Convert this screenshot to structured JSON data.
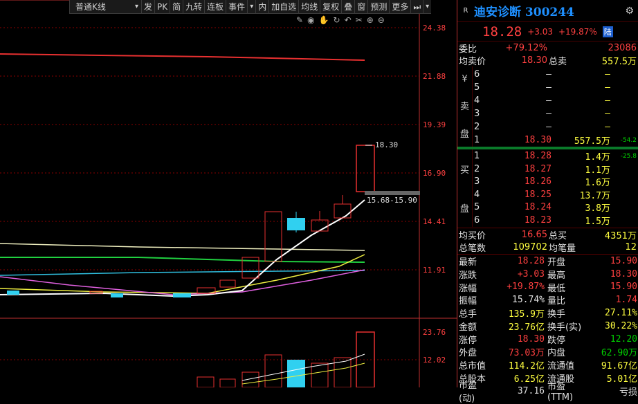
{
  "toolbar": {
    "items": [
      "普通K线",
      "发",
      "PK",
      "简",
      "九转",
      "连板",
      "事件",
      "内",
      "加自选",
      "均线",
      "复权",
      "叠",
      "窗",
      "预测",
      "更多"
    ],
    "arrow": "▾"
  },
  "chart": {
    "price_labels": [
      "24.38",
      "21.88",
      "19.39",
      "16.90",
      "14.41",
      "11.91"
    ],
    "volume_labels": [
      "23.76",
      "12.02"
    ],
    "high_annotation": "18.30",
    "range_annotation": "15.68-15.90",
    "tool_icons": [
      "pen-icon",
      "eye-icon",
      "hand-icon",
      "refresh-icon",
      "undo-icon",
      "scissors-icon",
      "zoom-in-icon",
      "zoom-out-icon"
    ]
  },
  "chart_data": {
    "type": "candlestick",
    "price_axis": [
      11.91,
      14.41,
      16.9,
      19.39,
      21.88,
      24.38
    ],
    "volume_axis": [
      12.02,
      23.76
    ],
    "annotations": [
      "18.30",
      "15.68-15.90"
    ]
  },
  "stock": {
    "r_mark": "R",
    "title": "迪安诊断 300244",
    "price": "18.28",
    "change": "+3.03",
    "pct": "+19.87%",
    "tag": "陆"
  },
  "summary": [
    {
      "label": "委比",
      "v1": "+79.12%",
      "label2": "",
      "v2": "23086"
    },
    {
      "label": "均卖价",
      "v1": "18.30",
      "label2": "总卖",
      "v2": "557.5万"
    }
  ],
  "sell_side": [
    "¥",
    "卖",
    "盘"
  ],
  "buy_side": [
    "买",
    "盘"
  ],
  "sell": [
    {
      "lvl": "6",
      "price": "–",
      "vol": "–",
      "chg": ""
    },
    {
      "lvl": "5",
      "price": "–",
      "vol": "–",
      "chg": ""
    },
    {
      "lvl": "4",
      "price": "–",
      "vol": "–",
      "chg": ""
    },
    {
      "lvl": "3",
      "price": "–",
      "vol": "–",
      "chg": ""
    },
    {
      "lvl": "2",
      "price": "–",
      "vol": "–",
      "chg": ""
    },
    {
      "lvl": "1",
      "price": "18.30",
      "vol": "557.5万",
      "chg": "-54.2"
    }
  ],
  "buy": [
    {
      "lvl": "1",
      "price": "18.28",
      "vol": "1.4万",
      "chg": "-25.8"
    },
    {
      "lvl": "2",
      "price": "18.27",
      "vol": "1.1万",
      "chg": ""
    },
    {
      "lvl": "3",
      "price": "18.26",
      "vol": "1.6万",
      "chg": ""
    },
    {
      "lvl": "4",
      "price": "18.25",
      "vol": "13.7万",
      "chg": ""
    },
    {
      "lvl": "5",
      "price": "18.24",
      "vol": "3.8万",
      "chg": ""
    },
    {
      "lvl": "6",
      "price": "18.23",
      "vol": "1.5万",
      "chg": ""
    }
  ],
  "buy_summary": [
    {
      "label": "均买价",
      "v1": "16.65",
      "label2": "总买",
      "v2": "4351万"
    },
    {
      "label": "总笔数",
      "v1": "109702",
      "label2": "均笔量",
      "v2": "12"
    }
  ],
  "stats": [
    {
      "l1": "最新",
      "v1": "18.28",
      "c1": "red",
      "l2": "开盘",
      "v2": "15.90",
      "c2": "red"
    },
    {
      "l1": "涨跌",
      "v1": "+3.03",
      "c1": "red",
      "l2": "最高",
      "v2": "18.30",
      "c2": "red"
    },
    {
      "l1": "涨幅",
      "v1": "+19.87%",
      "c1": "red",
      "l2": "最低",
      "v2": "15.90",
      "c2": "red"
    },
    {
      "l1": "振幅",
      "v1": "15.74%",
      "c1": "white",
      "l2": "量比",
      "v2": "1.74",
      "c2": "red"
    },
    {
      "l1": "总手",
      "v1": "135.9万",
      "c1": "yellow",
      "l2": "换手",
      "v2": "27.11%",
      "c2": "yellow"
    },
    {
      "l1": "金额",
      "v1": "23.76亿",
      "c1": "yellow",
      "l2": "换手(实)",
      "v2": "30.22%",
      "c2": "yellow"
    },
    {
      "l1": "涨停",
      "v1": "18.30",
      "c1": "red",
      "l2": "跌停",
      "v2": "12.20",
      "c2": "green"
    },
    {
      "l1": "外盘",
      "v1": "73.03万",
      "c1": "red",
      "l2": "内盘",
      "v2": "62.90万",
      "c2": "green"
    },
    {
      "l1": "总市值",
      "v1": "114.2亿",
      "c1": "yellow",
      "l2": "流通值",
      "v2": "91.67亿",
      "c2": "yellow"
    },
    {
      "l1": "总股本",
      "v1": "6.25亿",
      "c1": "yellow",
      "l2": "流通股",
      "v2": "5.01亿",
      "c2": "yellow"
    },
    {
      "l1": "市盈(动)",
      "v1": "37.16",
      "c1": "white",
      "l2": "市盈(TTM)",
      "v2": "亏损",
      "c2": "white"
    }
  ],
  "colors": {
    "up": "#ff4040",
    "down": "#00d000",
    "accent": "#1e90ff"
  }
}
